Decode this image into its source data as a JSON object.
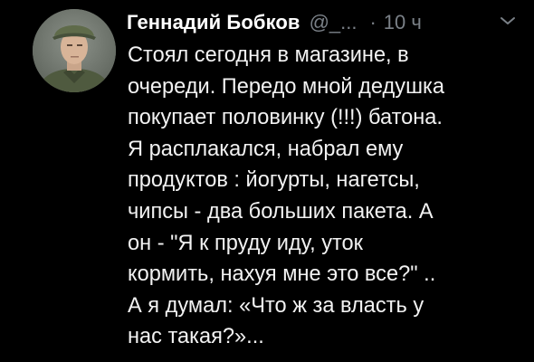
{
  "tweet": {
    "author_name": "Геннадий Бобков",
    "handle": "@_...",
    "separator": "·",
    "time": "10 ч",
    "avatar_icon": "user-photo",
    "menu_icon": "chevron-down-icon",
    "text_lines": [
      "Стоял сегодня в магазине, в",
      "очереди. Передо мной дедушка",
      "покупает половинку (!!!) батона.",
      "Я расплакался, набрал ему",
      "продуктов : йогурты, нагетсы,",
      "чипсы - два больших пакета. А",
      "он - \"Я к пруду иду, уток",
      "кормить, нахуя мне это все?\" ..",
      "А я думал: «Что ж за власть у",
      "нас такая?»..."
    ]
  },
  "colors": {
    "background": "#000000",
    "text": "#f2f2f2",
    "muted": "#7a8087"
  }
}
